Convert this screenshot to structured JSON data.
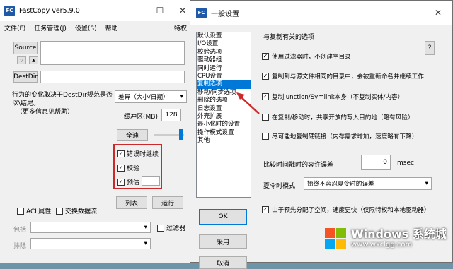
{
  "fastcopy": {
    "title": "FastCopy ver5.9.0",
    "window_controls": [
      "—",
      "☐",
      "✕"
    ],
    "menu": [
      "文件(F)",
      "任务管理(J)",
      "设置(S)",
      "帮助",
      "特权"
    ],
    "source_button": "Source",
    "destdir_button": "DestDir",
    "info_text_1": "行为的变化取决于DestDir规范是否",
    "info_text_2": "以\\结尾。",
    "info_text_3": "（更多信息见帮助）",
    "mode_select": "差异（大小/日期）",
    "buffer_label": "缓冲区(MB)",
    "buffer_value": "128",
    "fullspeed_button": "全速",
    "options": [
      {
        "label": "错误时继续",
        "checked": true
      },
      {
        "label": "校验",
        "checked": true
      },
      {
        "label": "预估",
        "checked": true
      }
    ],
    "acl_label": "ACL属性",
    "altstream_label": "交换数据流",
    "list_button": "列表",
    "run_button": "运行",
    "include_label": "包括",
    "exclude_label": "排除",
    "filter_label": "过滤器"
  },
  "settings": {
    "title": "一般设置",
    "close_glyph": "✕",
    "categories": [
      "默认设置",
      "I/O设置",
      "校验选项",
      "驱动器组",
      "同时运行",
      "CPU设置",
      "复制选项",
      "移动/同步选项",
      "删除的选项",
      "日志设置",
      "外壳扩展",
      "最小化时的设置",
      "操作模式设置",
      "其他"
    ],
    "selected_category": 6,
    "section_title": "与复制有关的选项",
    "help_button": "?",
    "options": [
      {
        "label": "使用过滤器时，不创建空目录",
        "checked": true
      },
      {
        "label": "复制到与源文件相同的目录中，会被重新命名并继续工作",
        "checked": true
      },
      {
        "label": "复制Junction/Symlink本身（不复制实体/内容）",
        "checked": true
      },
      {
        "label": "在复制/移动时，共享开放的写入目的地（略有风险）",
        "checked": false
      },
      {
        "label": "尽可能地复制硬链接（内存需求增加，速度略有下降）",
        "checked": false
      }
    ],
    "time_tolerance_label": "比较时间戳时的容许误差",
    "time_tolerance_value": "0",
    "time_tolerance_unit": "msec",
    "dst_mode_label": "夏令时模式",
    "dst_mode_value": "始终不容忍夏令时的误差",
    "prealloc_label": "由于预先分配了空间，速度更快（仅限特权和本地驱动器）",
    "prealloc_checked": true,
    "ok_button": "OK",
    "apply_button": "采用",
    "cancel_button": "取消"
  },
  "watermark": {
    "title": "Windows 系统城",
    "url": "www.wxclgg.com"
  },
  "colors": {
    "accent": "#0078d7",
    "highlight_box": "#cc2a2a",
    "arrow": "#cc2a2a",
    "fc_icon": "#1e5aa8"
  }
}
